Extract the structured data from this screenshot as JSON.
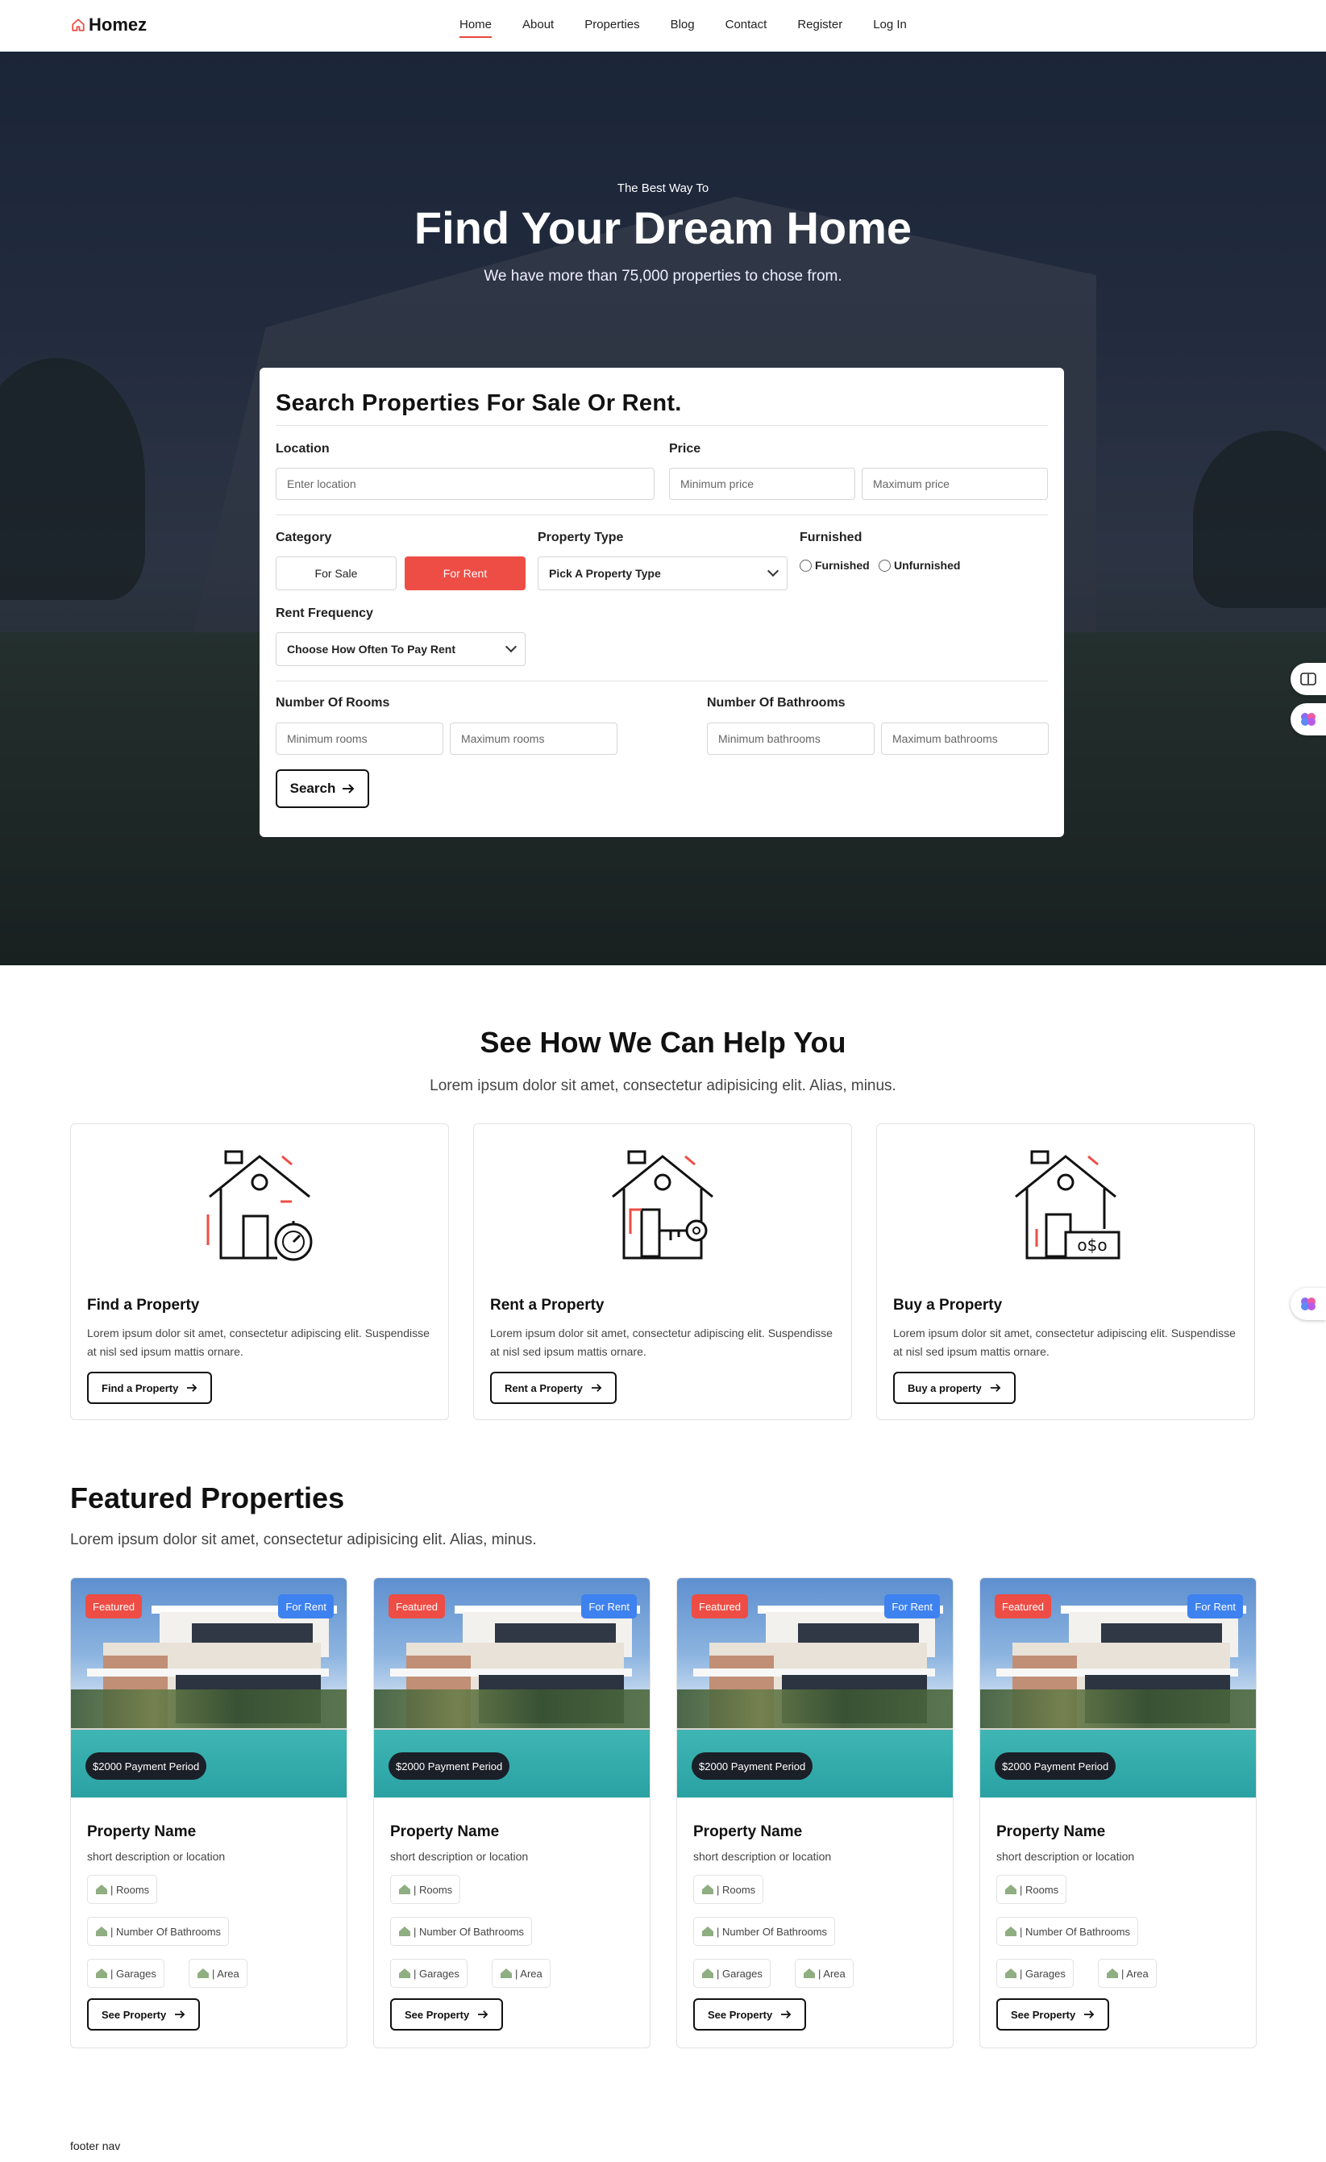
{
  "brand": {
    "name": "Homez",
    "accent": "#ee4d45",
    "blue": "#3e82f0"
  },
  "nav": {
    "items": [
      {
        "label": "Home"
      },
      {
        "label": "About"
      },
      {
        "label": "Properties"
      },
      {
        "label": "Blog"
      },
      {
        "label": "Contact"
      },
      {
        "label": "Register"
      },
      {
        "label": "Log In"
      }
    ],
    "active": "Home"
  },
  "hero": {
    "kicker": "The Best Way To",
    "title": "Find Your Dream Home",
    "subtitle": "We have more than 75,000 properties to chose from."
  },
  "search": {
    "title": "Search Properties For Sale Or Rent.",
    "location_label": "Location",
    "location_placeholder": "Enter location",
    "price_label": "Price",
    "min_price_placeholder": "Minimum price",
    "max_price_placeholder": "Maximum price",
    "category_label": "Category",
    "category_sale": "For Sale",
    "category_rent": "For Rent",
    "category_selected": "For Rent",
    "property_type_label": "Property Type",
    "property_type_value": "Pick A Property Type",
    "furnished_label": "Furnished",
    "furnished_option": "Furnished",
    "unfurnished_option": "Unfurnished",
    "rent_frequency_label": "Rent Frequency",
    "rent_frequency_value": "Choose How Often To Pay Rent",
    "rooms_label": "Number Of Rooms",
    "min_rooms_placeholder": "Minimum rooms",
    "max_rooms_placeholder": "Maximum rooms",
    "bathrooms_label": "Number Of Bathrooms",
    "min_bathrooms_placeholder": "Minimum bathrooms",
    "max_bathrooms_placeholder": "Maximum bathrooms",
    "search_button": "Search"
  },
  "help": {
    "title": "See How We Can Help You",
    "subtitle": "Lorem ipsum dolor sit amet, consectetur adipisicing elit. Alias, minus.",
    "cards": [
      {
        "title": "Find a Property",
        "text": "Lorem ipsum dolor sit amet, consectetur adipiscing elit. Suspendisse at nisl sed ipsum mattis ornare.",
        "button": "Find a Property",
        "icon": "house-timer-icon"
      },
      {
        "title": "Rent a Property",
        "text": "Lorem ipsum dolor sit amet, consectetur adipiscing elit. Suspendisse at nisl sed ipsum mattis ornare.",
        "button": "Rent a Property",
        "icon": "house-key-icon"
      },
      {
        "title": "Buy a Property",
        "text": "Lorem ipsum dolor sit amet, consectetur adipiscing elit. Suspendisse at nisl sed ipsum mattis ornare.",
        "button": "Buy a property",
        "icon": "house-dollar-icon"
      }
    ]
  },
  "featured": {
    "title": "Featured Properties",
    "subtitle": "Lorem ipsum dolor sit amet, consectetur adipisicing elit. Alias, minus.",
    "properties": [
      {
        "badge_featured": "Featured",
        "badge_status": "For Rent",
        "price": "$2000 Payment Period",
        "name": "Property Name",
        "desc": "short description or location",
        "rooms": "| Rooms",
        "bathrooms": "| Number Of Bathrooms",
        "garages": "| Garages",
        "area": "| Area",
        "button": "See Property"
      },
      {
        "badge_featured": "Featured",
        "badge_status": "For Rent",
        "price": "$2000 Payment Period",
        "name": "Property Name",
        "desc": "short description or location",
        "rooms": "| Rooms",
        "bathrooms": "| Number Of Bathrooms",
        "garages": "| Garages",
        "area": "| Area",
        "button": "See Property"
      },
      {
        "badge_featured": "Featured",
        "badge_status": "For Rent",
        "price": "$2000 Payment Period",
        "name": "Property Name",
        "desc": "short description or location",
        "rooms": "| Rooms",
        "bathrooms": "| Number Of Bathrooms",
        "garages": "| Garages",
        "area": "| Area",
        "button": "See Property"
      },
      {
        "badge_featured": "Featured",
        "badge_status": "For Rent",
        "price": "$2000 Payment Period",
        "name": "Property Name",
        "desc": "short description or location",
        "rooms": "| Rooms",
        "bathrooms": "| Number Of Bathrooms",
        "garages": "| Garages",
        "area": "| Area",
        "button": "See Property"
      }
    ]
  },
  "footer": {
    "label": "footer nav"
  }
}
